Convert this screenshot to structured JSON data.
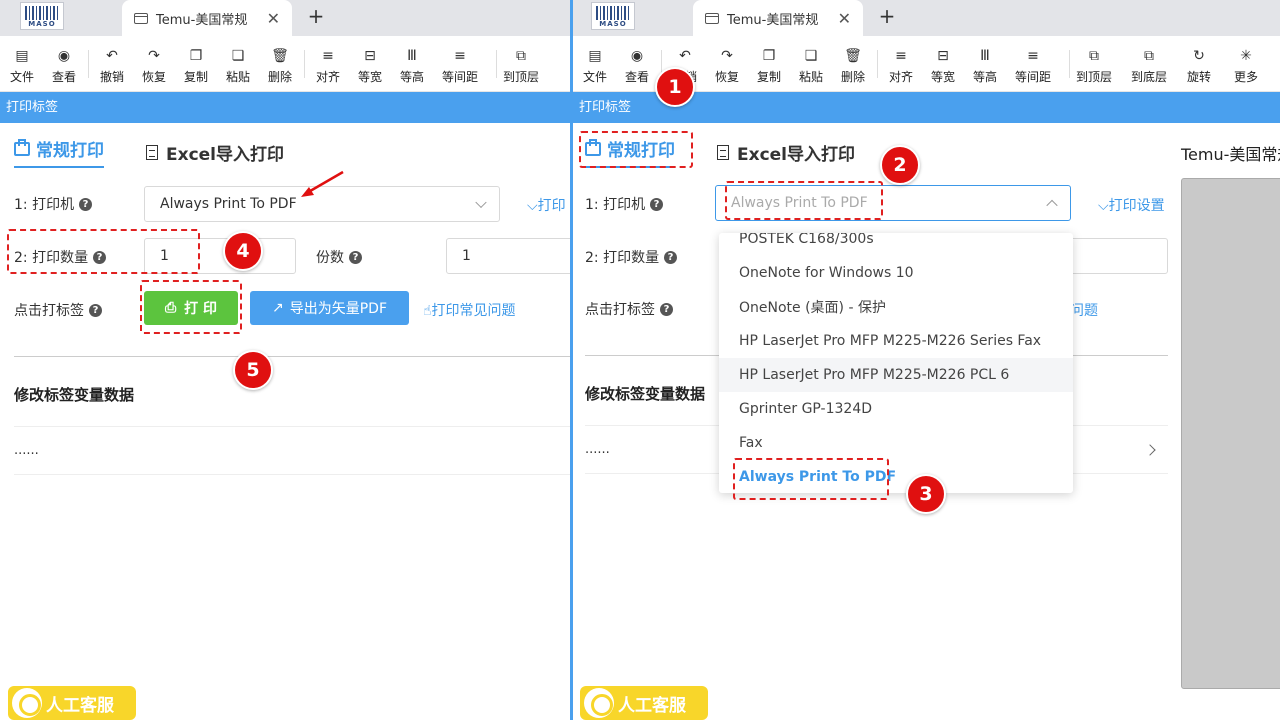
{
  "app": {
    "logo_text": "MASO",
    "tab_title": "Temu-美国常规",
    "tab_close": "✕",
    "tab_add": "+"
  },
  "toolbar_left": [
    {
      "label": "文件",
      "icon": "file-icon"
    },
    {
      "label": "查看",
      "icon": "eye-icon"
    },
    {
      "label": "撤销",
      "icon": "undo-icon"
    },
    {
      "label": "恢复",
      "icon": "redo-icon"
    },
    {
      "label": "复制",
      "icon": "copy-icon"
    },
    {
      "label": "粘贴",
      "icon": "paste-icon"
    },
    {
      "label": "删除",
      "icon": "trash-icon"
    },
    {
      "label": "对齐",
      "icon": "align-icon"
    },
    {
      "label": "等宽",
      "icon": "equal-width-icon"
    },
    {
      "label": "等高",
      "icon": "equal-height-icon"
    },
    {
      "label": "等间距",
      "icon": "equal-spacing-icon"
    },
    {
      "label": "到顶层",
      "icon": "bring-front-icon"
    }
  ],
  "toolbar_right": [
    {
      "label": "文件",
      "icon": "file-icon"
    },
    {
      "label": "查看",
      "icon": "eye-icon"
    },
    {
      "label": "撤销",
      "icon": "undo-icon"
    },
    {
      "label": "恢复",
      "icon": "redo-icon"
    },
    {
      "label": "复制",
      "icon": "copy-icon"
    },
    {
      "label": "粘贴",
      "icon": "paste-icon"
    },
    {
      "label": "删除",
      "icon": "trash-icon"
    },
    {
      "label": "对齐",
      "icon": "align-icon"
    },
    {
      "label": "等宽",
      "icon": "equal-width-icon"
    },
    {
      "label": "等高",
      "icon": "equal-height-icon"
    },
    {
      "label": "等间距",
      "icon": "equal-spacing-icon"
    },
    {
      "label": "到顶层",
      "icon": "bring-front-icon"
    },
    {
      "label": "到底层",
      "icon": "send-back-icon"
    },
    {
      "label": "旋转",
      "icon": "rotate-icon"
    },
    {
      "label": "更多",
      "icon": "more-icon"
    }
  ],
  "panel_title": "打印标签",
  "main_tabs": {
    "normal": "常规打印",
    "excel": "Excel导入打印"
  },
  "form": {
    "printer_label": "1: 打印机",
    "printer_value": "Always Print To PDF",
    "print_settings_link": "打印设置",
    "print_settings_link_short": "打印",
    "quantity_label": "2: 打印数量",
    "quantity_value": "1",
    "copies_label": "份数",
    "copies_value": "1",
    "click_label": "点击打标签",
    "print_button": "打 印",
    "export_button": "导出为矢量PDF",
    "faq_link": "打印常见问题",
    "faq_link_partial": "问题",
    "help_glyph": "?"
  },
  "section": {
    "title": "修改标签变量数据",
    "row_text": "......"
  },
  "dropdown": {
    "options": [
      "POSTEK C168/300s",
      "OneNote for Windows 10",
      "OneNote (桌面) - 保护",
      "HP LaserJet Pro MFP M225-M226 Series Fax",
      "HP LaserJet Pro MFP M225-M226 PCL 6",
      "Gprinter GP-1324D",
      "Fax",
      "Always Print To PDF"
    ],
    "hover_index": 4,
    "selected_index": 7
  },
  "preview_title": "Temu-美国常规",
  "customer_service": "人工客服",
  "badges": [
    "1",
    "2",
    "3",
    "4",
    "5"
  ],
  "colors": {
    "accent": "#3d98e8",
    "title_bar": "#4aa0ee",
    "print_green": "#5cc43e",
    "badge_red": "#e01010",
    "cs_yellow": "#f8d62a"
  }
}
